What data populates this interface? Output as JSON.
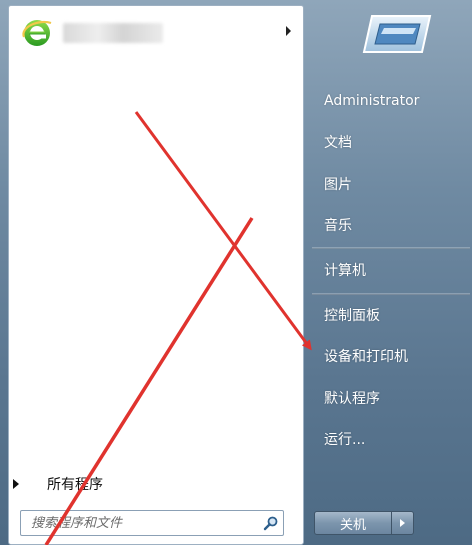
{
  "left_pane": {
    "pinned_icon": "ie-logo-icon",
    "all_programs_label": "所有程序",
    "search": {
      "placeholder": "搜索程序和文件",
      "value": ""
    }
  },
  "right_pane": {
    "items": [
      {
        "label": "Administrator"
      },
      {
        "label": "文档"
      },
      {
        "label": "图片"
      },
      {
        "label": "音乐"
      },
      {
        "label": "计算机"
      },
      {
        "label": "控制面板"
      },
      {
        "label": "设备和打印机"
      },
      {
        "label": "默认程序"
      },
      {
        "label": "运行..."
      }
    ],
    "shutdown_label": "关机"
  },
  "colors": {
    "arrow": "#e0332e",
    "accent": "#6f8aa2"
  }
}
